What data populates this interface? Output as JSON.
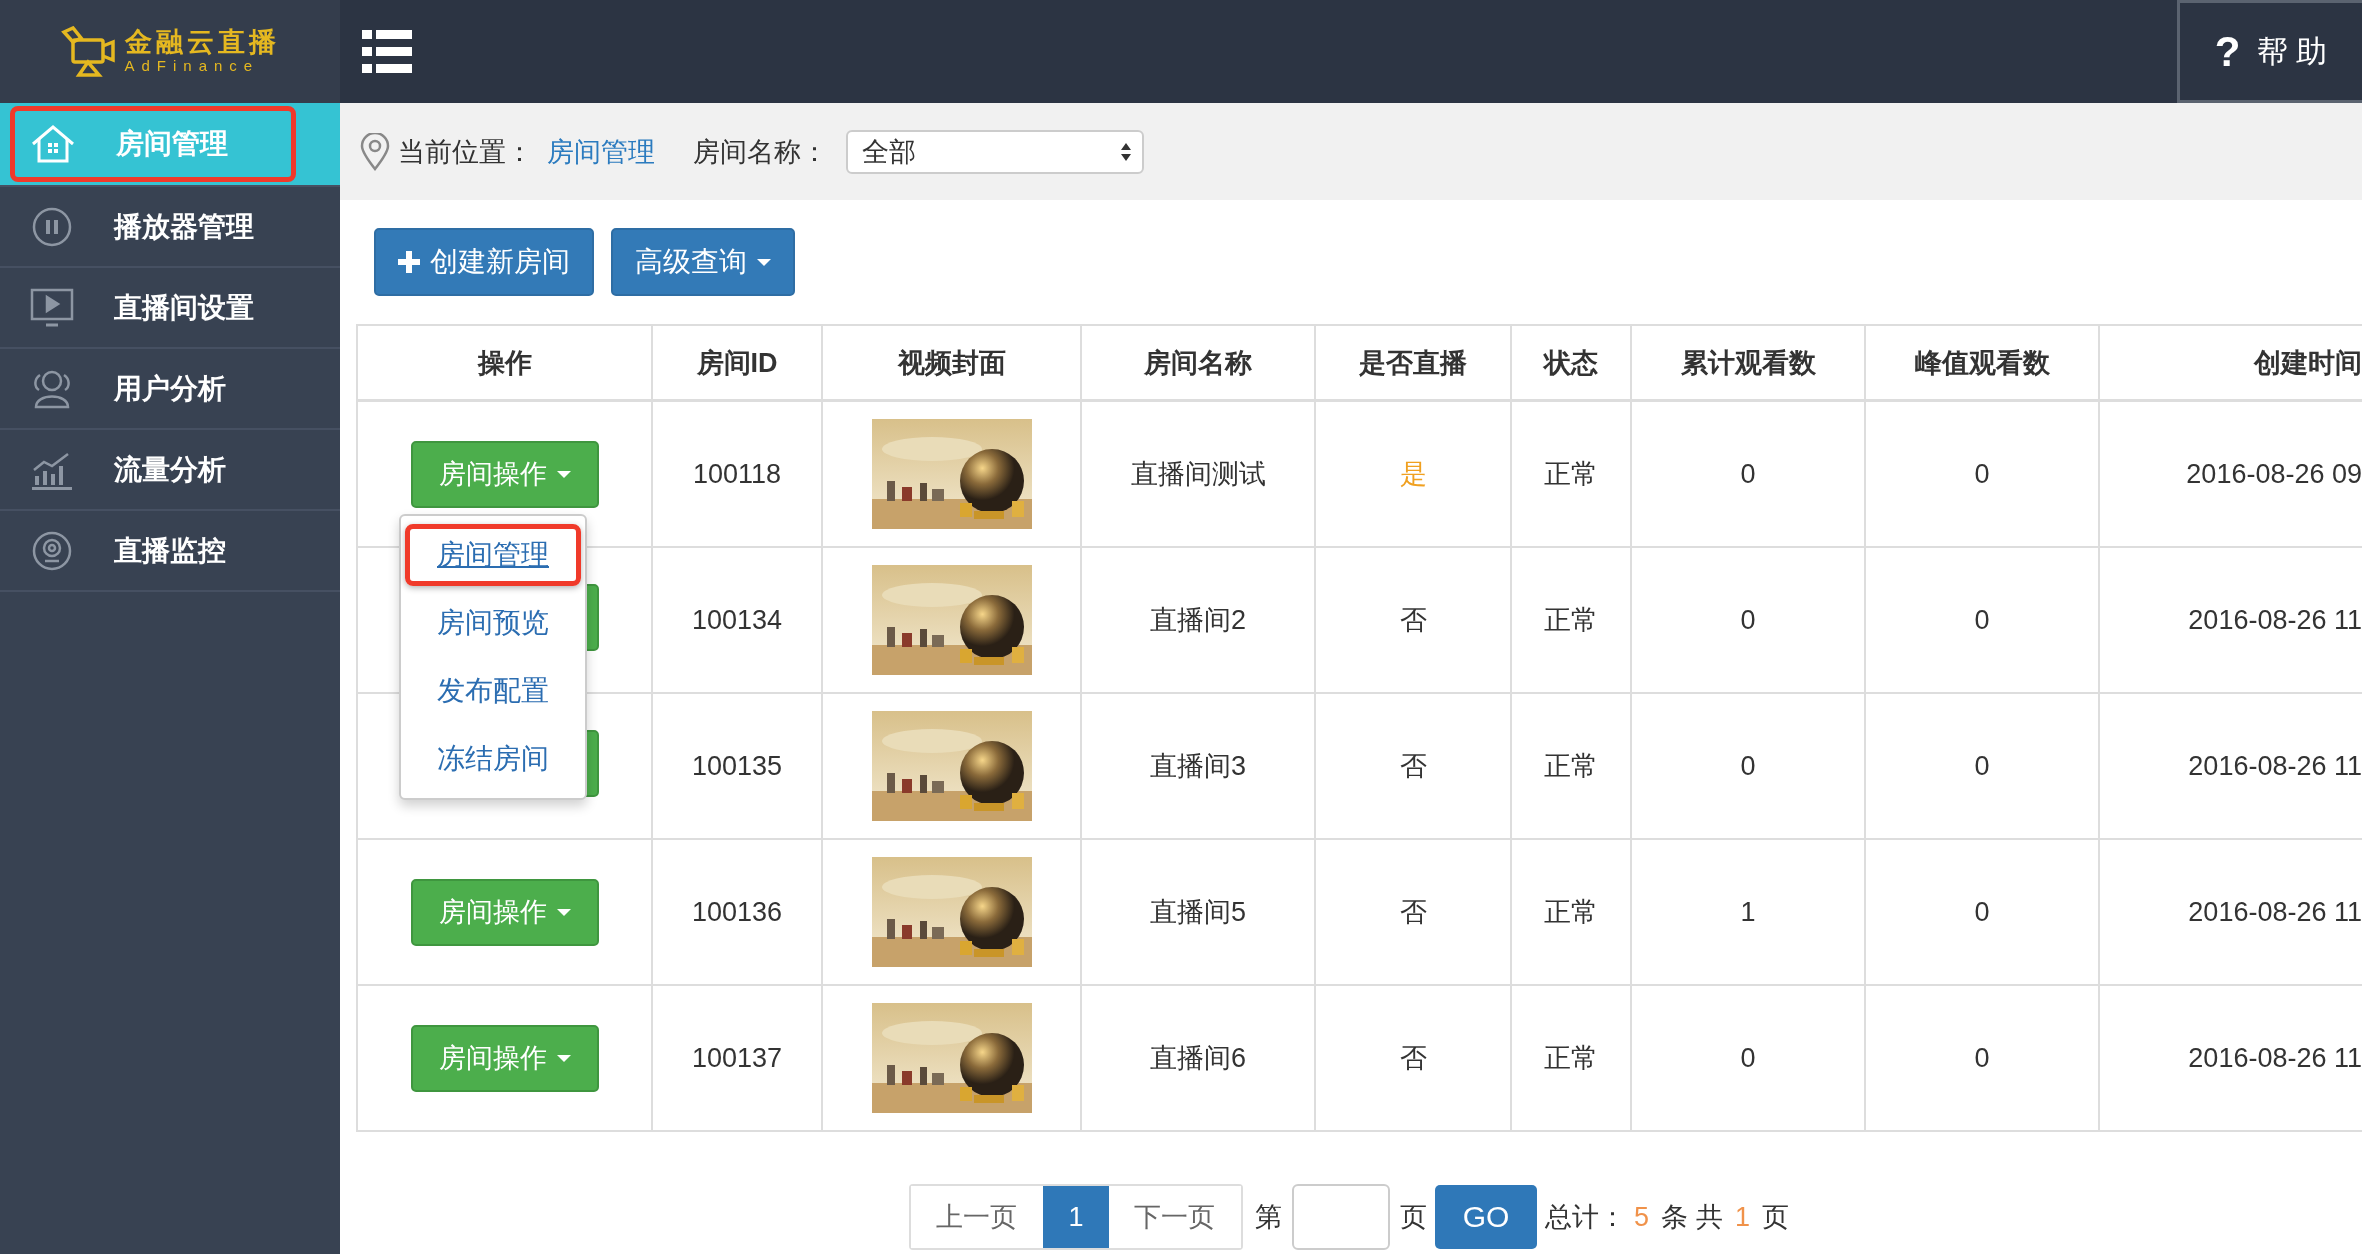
{
  "logo": {
    "title": "金融云直播",
    "subtitle": "AdFinance"
  },
  "sidebar": {
    "items": [
      {
        "label": "房间管理",
        "selected": true,
        "highlighted": true
      },
      {
        "label": "播放器管理",
        "selected": false,
        "highlighted": false
      },
      {
        "label": "直播间设置",
        "selected": false,
        "highlighted": false
      },
      {
        "label": "用户分析",
        "selected": false,
        "highlighted": false
      },
      {
        "label": "流量分析",
        "selected": false,
        "highlighted": false
      },
      {
        "label": "直播监控",
        "selected": false,
        "highlighted": false
      }
    ]
  },
  "header": {
    "help_icon": "?",
    "help": "帮 助"
  },
  "breadcrumb": {
    "label": "当前位置：",
    "current": "房间管理",
    "filter_label": "房间名称：",
    "filter_value": "全部"
  },
  "toolbar": {
    "buttons": [
      {
        "label": "创建新房间",
        "kind": "create"
      },
      {
        "label": "高级查询",
        "kind": "dropdown"
      }
    ]
  },
  "table": {
    "columns": [
      "操作",
      "房间ID",
      "视频封面",
      "房间名称",
      "是否直播",
      "状态",
      "累计观看数",
      "峰值观看数",
      "创建时间"
    ],
    "rows": [
      {
        "action": "房间操作",
        "menu": [
          {
            "label": "房间管理",
            "highlighted": true
          },
          {
            "label": "房间预览",
            "highlighted": false
          },
          {
            "label": "发布配置",
            "highlighted": false
          },
          {
            "label": "冻结房间",
            "highlighted": false
          }
        ],
        "id": "100118",
        "name": "直播间测试",
        "live": true,
        "live_text": "是",
        "status": "正常",
        "total_views": "0",
        "peak_views": "0",
        "created": "2016-08-26 09"
      },
      {
        "id": "100134",
        "name": "直播间2",
        "live": false,
        "live_text": "否",
        "status": "正常",
        "total_views": "0",
        "peak_views": "0",
        "created": "2016-08-26 11"
      },
      {
        "id": "100135",
        "name": "直播间3",
        "live": false,
        "live_text": "否",
        "status": "正常",
        "total_views": "0",
        "peak_views": "0",
        "created": "2016-08-26 11"
      },
      {
        "action": "房间操作",
        "id": "100136",
        "name": "直播间5",
        "live": false,
        "live_text": "否",
        "status": "正常",
        "total_views": "1",
        "peak_views": "0",
        "created": "2016-08-26 11"
      },
      {
        "action": "房间操作",
        "id": "100137",
        "name": "直播间6",
        "live": false,
        "live_text": "否",
        "status": "正常",
        "total_views": "0",
        "peak_views": "0",
        "created": "2016-08-26 11"
      }
    ]
  },
  "pagination": {
    "prev": "上一页",
    "pages": [
      {
        "label": "1",
        "selected": true
      }
    ],
    "next": "下一页",
    "goto_prefix": "第",
    "goto_suffix": "页",
    "go": "GO",
    "total_prefix": "总计：",
    "total_count": "5",
    "count_unit": "条",
    "pages_prefix": "共",
    "page_count": "1",
    "pages_unit": "页"
  }
}
